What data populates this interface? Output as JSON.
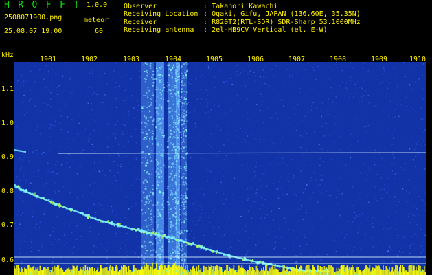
{
  "header": {
    "title": "H R O F F T",
    "version": "1.0.0",
    "file_name": "2508071900.png",
    "mode_label": "meteor",
    "timestamp": "25.08.07 19:00",
    "count": "60",
    "info": [
      {
        "label": "Observer",
        "value": ": Takanori Kawachi"
      },
      {
        "label": "Receiving Location",
        "value": ": Ogaki, Gifu, JAPAN (136.60E, 35.35N)"
      },
      {
        "label": "Receiver",
        "value": ": R820T2(RTL-SDR) SDR-Sharp 53.1000MHz"
      },
      {
        "label": "Receiving antenna",
        "value": ": 2el-HB9CV Vertical (el. E-W)"
      }
    ]
  },
  "spectrogram": {
    "y_unit": "kHz",
    "time_ticks": [
      "1901",
      "1902",
      "1903",
      "1904",
      "1905",
      "1906",
      "1907",
      "1908",
      "1909",
      "1910"
    ],
    "freq_ticks": [
      "1.1",
      "1.0",
      "0.9",
      "0.8",
      "0.7",
      "0.6"
    ],
    "colors": {
      "background": "#1233a8",
      "noise": "#2f65ff",
      "signal": "#7ff8ff",
      "strong_signal": "#b7ff4b",
      "lines": "#d9f5ff",
      "bottom_band": "#ffff00"
    }
  }
}
